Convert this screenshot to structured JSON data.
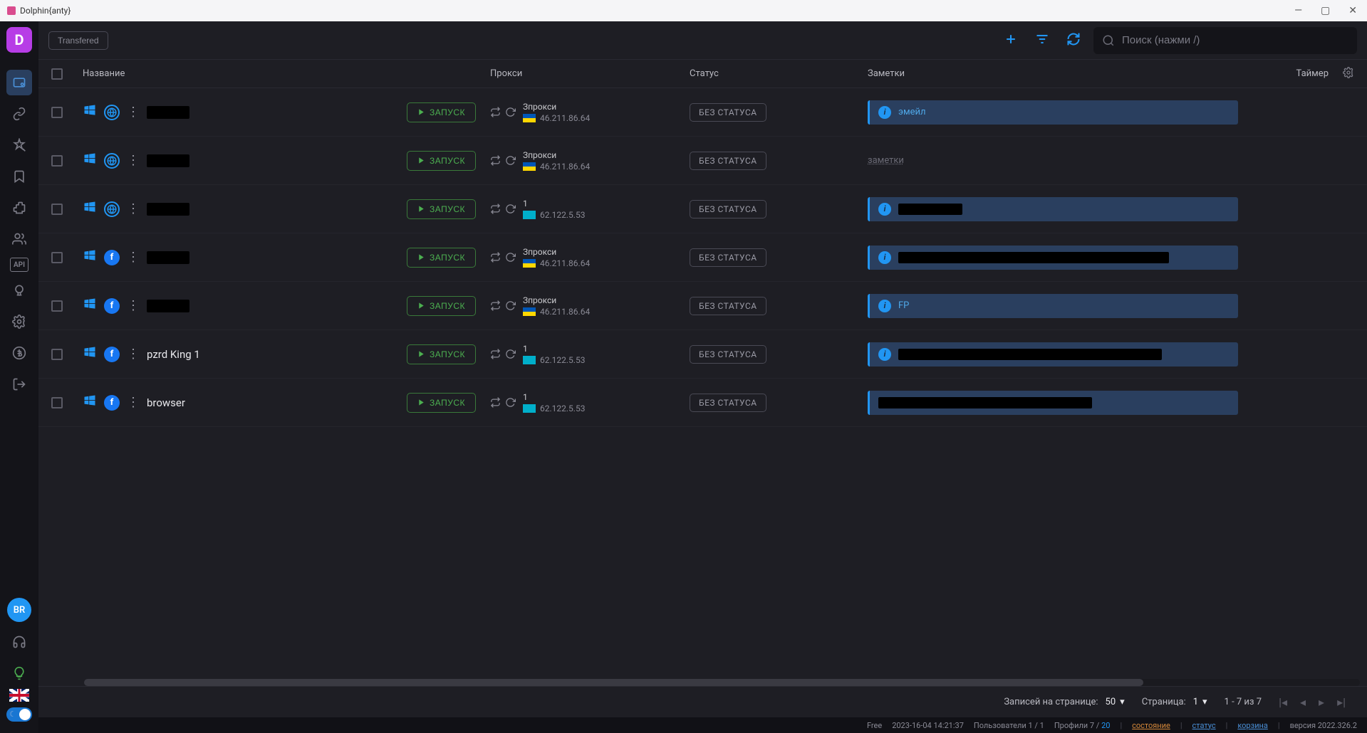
{
  "window": {
    "title": "Dolphin{anty}"
  },
  "topbar": {
    "tag_label": "Transfered",
    "search_placeholder": "Поиск (нажми /)"
  },
  "columns": {
    "name": "Название",
    "proxy": "Прокси",
    "status": "Статус",
    "notes": "Заметки",
    "timer": "Таймер"
  },
  "launch_label": "ЗАПУСК",
  "status_label": "БЕЗ СТАТУСА",
  "notes_placeholder": "заметки",
  "rows": [
    {
      "name": "",
      "redacted_name": true,
      "platform": "globe",
      "proxy_name": "Зпрокси",
      "proxy_ip": "46.211.86.64",
      "flag": "ua",
      "note_type": "pill",
      "note_text": "эмейл",
      "note_redact_w": 0
    },
    {
      "name": "",
      "redacted_name": true,
      "platform": "globe",
      "proxy_name": "Зпрокси",
      "proxy_ip": "46.211.86.64",
      "flag": "ua",
      "note_type": "placeholder",
      "note_text": "",
      "note_redact_w": 0
    },
    {
      "name": "",
      "redacted_name": true,
      "platform": "globe",
      "proxy_name": "1",
      "proxy_ip": "62.122.5.53",
      "flag": "kz",
      "note_type": "pill",
      "note_text": "",
      "note_redact_w": 90
    },
    {
      "name": "",
      "redacted_name": true,
      "platform": "fb",
      "proxy_name": "Зпрокси",
      "proxy_ip": "46.211.86.64",
      "flag": "ua",
      "note_type": "pill",
      "note_text": "",
      "note_redact_w": 380
    },
    {
      "name": "",
      "redacted_name": true,
      "platform": "fb",
      "proxy_name": "Зпрокси",
      "proxy_ip": "46.211.86.64",
      "flag": "ua",
      "note_type": "pill",
      "note_text": "FP",
      "note_redact_w": 0
    },
    {
      "name": "pzrd King 1",
      "redacted_name": false,
      "platform": "fb",
      "proxy_name": "1",
      "proxy_ip": "62.122.5.53",
      "flag": "kz",
      "note_type": "pill",
      "note_text": "",
      "note_redact_w": 370
    },
    {
      "name": "browser",
      "redacted_name": false,
      "platform": "fb",
      "proxy_name": "1",
      "proxy_ip": "62.122.5.53",
      "flag": "kz",
      "note_type": "pill-noicon",
      "note_text": "",
      "note_redact_w": 300
    }
  ],
  "pagination": {
    "per_page_label": "Записей на странице:",
    "per_page_value": "50",
    "page_label": "Страница:",
    "page_value": "1",
    "range": "1 - 7 из 7"
  },
  "statusbar": {
    "plan": "Free",
    "datetime": "2023-16-04 14:21:37",
    "users_label": "Пользователи",
    "users_value": "1 / 1",
    "profiles_label": "Профили",
    "profiles_cur": "7",
    "profiles_max": "20",
    "link_status": "состояние",
    "link_status2": "статус",
    "link_trash": "корзина",
    "version": "версия 2022.326.2"
  },
  "avatar": "BR"
}
